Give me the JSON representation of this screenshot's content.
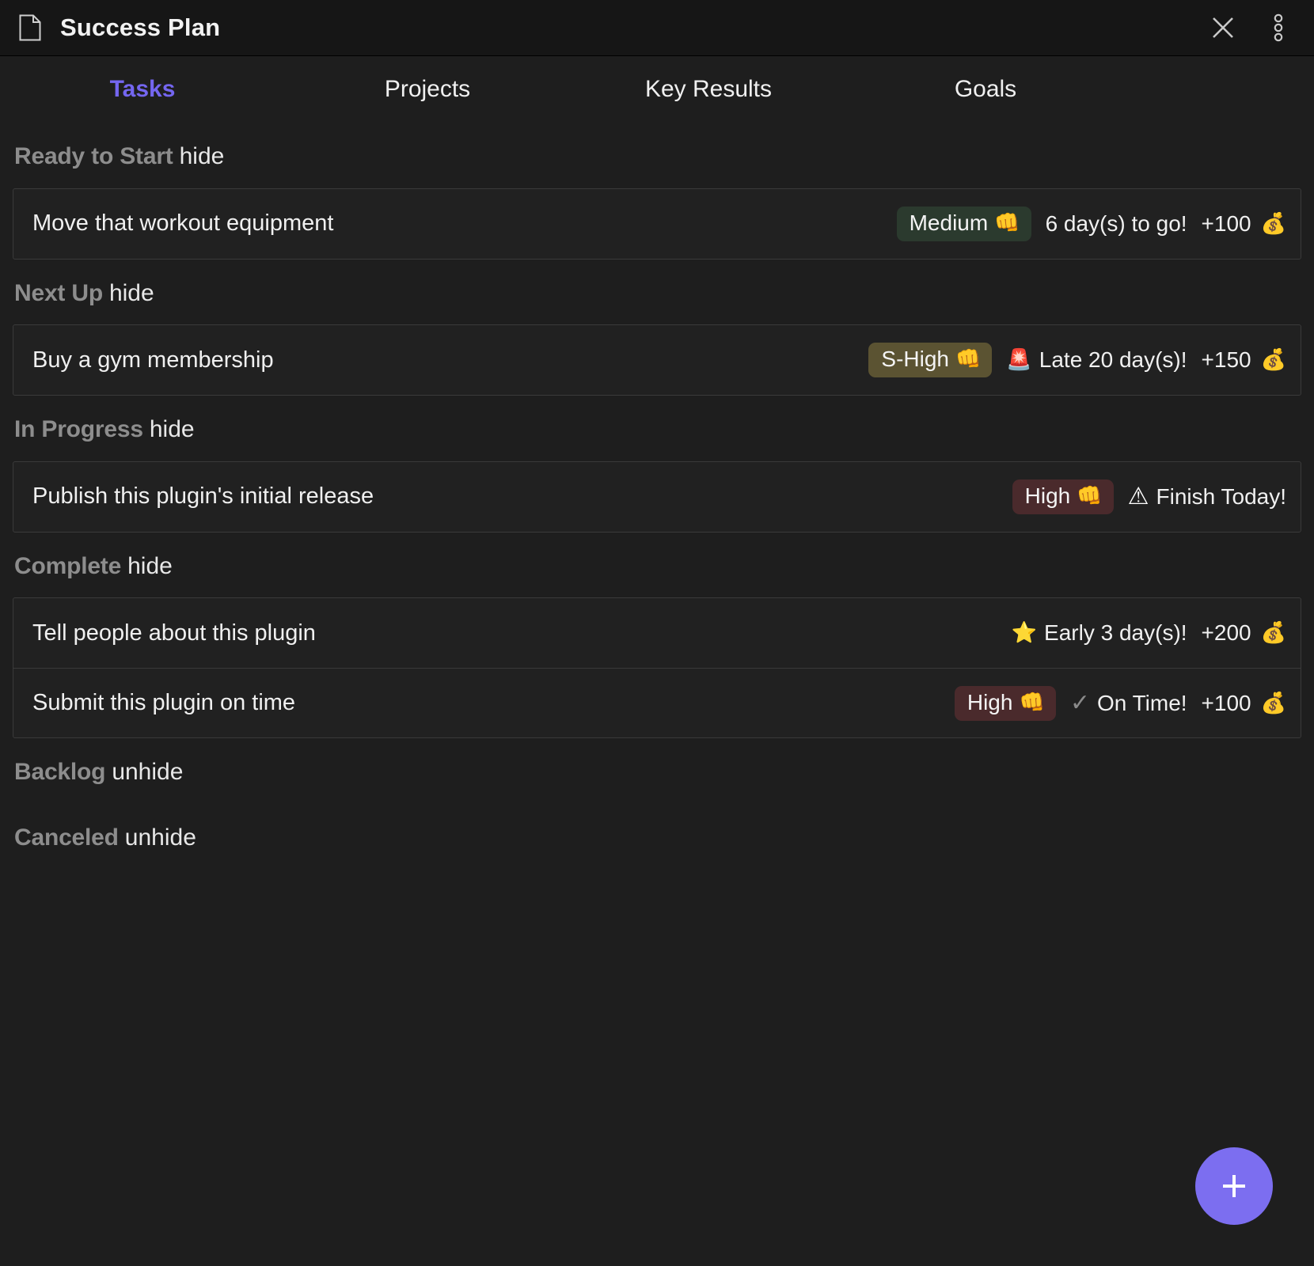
{
  "window": {
    "title": "Success Plan",
    "icon": "document-icon",
    "close_label": "✕",
    "menu_label": "more-options"
  },
  "tabs": [
    {
      "label": "Tasks",
      "active": true
    },
    {
      "label": "Projects",
      "active": false
    },
    {
      "label": "Key Results",
      "active": false
    },
    {
      "label": "Goals",
      "active": false
    }
  ],
  "sections": [
    {
      "title": "Ready to Start",
      "toggle": "hide",
      "collapsed": false,
      "tasks": [
        {
          "title": "Move that workout equipment",
          "priority": "Medium",
          "priority_emoji": "👊",
          "priority_style": "badge-medium",
          "status_icon": "",
          "status_text": "6 day(s) to go!",
          "points": "+100",
          "points_emoji": "💰"
        }
      ]
    },
    {
      "title": "Next Up",
      "toggle": "hide",
      "collapsed": false,
      "tasks": [
        {
          "title": "Buy a gym membership",
          "priority": "S-High",
          "priority_emoji": "👊",
          "priority_style": "badge-shigh",
          "status_icon": "🚨",
          "status_text": "Late 20 day(s)!",
          "points": "+150",
          "points_emoji": "💰"
        }
      ]
    },
    {
      "title": "In Progress",
      "toggle": "hide",
      "collapsed": false,
      "tasks": [
        {
          "title": "Publish this plugin's initial release",
          "priority": "High",
          "priority_emoji": "👊",
          "priority_style": "badge-high",
          "status_icon": "⚠",
          "status_icon_kind": "warning",
          "status_text": "Finish Today!",
          "points": "",
          "points_emoji": ""
        }
      ]
    },
    {
      "title": "Complete",
      "toggle": "hide",
      "collapsed": false,
      "tasks": [
        {
          "title": "Tell people about this plugin",
          "priority": "",
          "priority_emoji": "",
          "priority_style": "",
          "status_icon": "⭐",
          "status_text": "Early 3 day(s)!",
          "points": "+200",
          "points_emoji": "💰"
        },
        {
          "title": "Submit this plugin on time",
          "priority": "High",
          "priority_emoji": "👊",
          "priority_style": "badge-high",
          "status_icon": "✓",
          "status_icon_kind": "check",
          "status_text": "On Time!",
          "points": "+100",
          "points_emoji": "💰"
        }
      ]
    },
    {
      "title": "Backlog",
      "toggle": "unhide",
      "collapsed": true,
      "tasks": []
    },
    {
      "title": "Canceled",
      "toggle": "unhide",
      "collapsed": true,
      "tasks": []
    }
  ],
  "fab": {
    "label": "+",
    "name": "add-task-button",
    "color": "#7c6ef0"
  },
  "colors": {
    "background": "#1e1e1e",
    "titlebar": "#161616",
    "accent": "#7466f0",
    "fab": "#7c6ef0",
    "row_border": "#3a3a3a",
    "section_title": "#8d8d8d",
    "badge_medium": "#2b3a2e",
    "badge_shigh": "#5b5332",
    "badge_high": "#4a2a2c"
  }
}
